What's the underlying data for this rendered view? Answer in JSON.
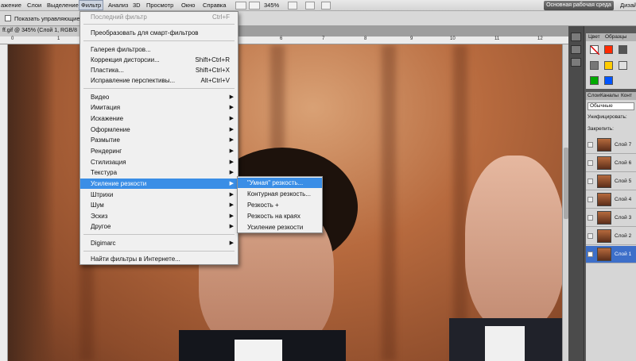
{
  "menubar": {
    "items": [
      "ажение",
      "Слои",
      "Выделение",
      "Фильтр",
      "Анализ",
      "3D",
      "Просмотр",
      "Окно",
      "Справка"
    ],
    "zoom": "345%",
    "workspace": "Основная рабочая среда",
    "design": "Дизай"
  },
  "options": {
    "show_controls": "Показать управляющие эл"
  },
  "document": {
    "tab_title": "ff.gif @ 345% (Слой 1, RGB/8"
  },
  "ruler": {
    "ticks": [
      "0",
      "1",
      "2",
      "3",
      "4",
      "5",
      "6",
      "7",
      "8",
      "9",
      "10",
      "11",
      "12"
    ]
  },
  "filter_menu": {
    "last_filter": {
      "label": "Последний фильтр",
      "shortcut": "Ctrl+F"
    },
    "convert_smart": "Преобразовать для смарт-фильтров",
    "gallery": "Галерея фильтров...",
    "lens_correction": {
      "label": "Коррекция дисторсии...",
      "shortcut": "Shift+Ctrl+R"
    },
    "liquify": {
      "label": "Пластика...",
      "shortcut": "Shift+Ctrl+X"
    },
    "vanishing_point": {
      "label": "Исправление перспективы...",
      "shortcut": "Alt+Ctrl+V"
    },
    "submenus": [
      "Видео",
      "Имитация",
      "Искажение",
      "Оформление",
      "Размытие",
      "Рендеринг",
      "Стилизация",
      "Текстура",
      "Усиление резкости",
      "Штрихи",
      "Шум",
      "Эскиз",
      "Другое"
    ],
    "digimarc": "Digimarc",
    "browse_online": "Найти фильтры в Интернете..."
  },
  "sharpen_submenu": {
    "items": [
      "\"Умная\" резкость...",
      "Контурная резкость...",
      "Резкость +",
      "Резкость на краях",
      "Усиление резкости"
    ]
  },
  "color_panel": {
    "tabs": [
      "Цвет",
      "Образцы"
    ],
    "swatch_colors": [
      "#ff0000",
      "#ffffff",
      "#e0e0e0",
      "#777777",
      "#ff2a00",
      "#ffcc00",
      "#00aa00",
      "#0055ff"
    ]
  },
  "layers_panel": {
    "tabs": [
      "Слои",
      "Каналы",
      "Конт"
    ],
    "blend_mode": "Обычные",
    "unify_label": "Унифицировать:",
    "lock_label": "Закрепить:",
    "layers": [
      "Слой 7",
      "Слой 6",
      "Слой 5",
      "Слой 4",
      "Слой 3",
      "Слой 2",
      "Слой 1"
    ],
    "selected_layer": "Слой 1"
  }
}
